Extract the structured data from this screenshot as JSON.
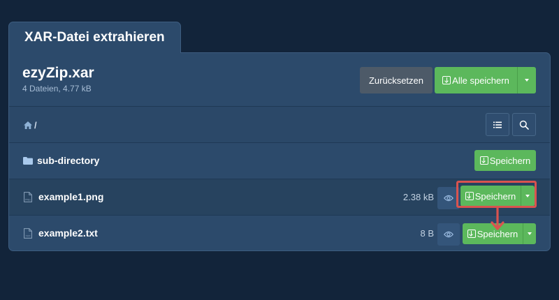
{
  "tab": {
    "title": "XAR-Datei extrahieren"
  },
  "archive": {
    "name": "ezyZip.xar",
    "meta": "4 Dateien, 4.77 kB"
  },
  "actions": {
    "reset_label": "Zurücksetzen",
    "save_all_label": "Alle speichern"
  },
  "breadcrumb": {
    "separator": "/"
  },
  "rows": [
    {
      "type": "folder",
      "name": "sub-directory",
      "size": "",
      "save_label": "Speichern"
    },
    {
      "type": "file",
      "name": "example1.png",
      "size": "2.38 kB",
      "save_label": "Speichern",
      "icon_text": "PNG"
    },
    {
      "type": "file",
      "name": "example2.txt",
      "size": "8 B",
      "save_label": "Speichern",
      "icon_text": "TXT"
    }
  ],
  "colors": {
    "background": "#12243a",
    "panel": "#2c4a6b",
    "accent_green": "#5cb85c",
    "reset_button": "#4d5a68",
    "highlight_red": "#d9534f"
  },
  "icons": [
    "home-icon",
    "list-view-icon",
    "search-icon",
    "folder-icon",
    "file-png-icon",
    "file-txt-icon",
    "eye-icon",
    "download-icon",
    "chevron-down-icon",
    "arrow-down-icon"
  ]
}
